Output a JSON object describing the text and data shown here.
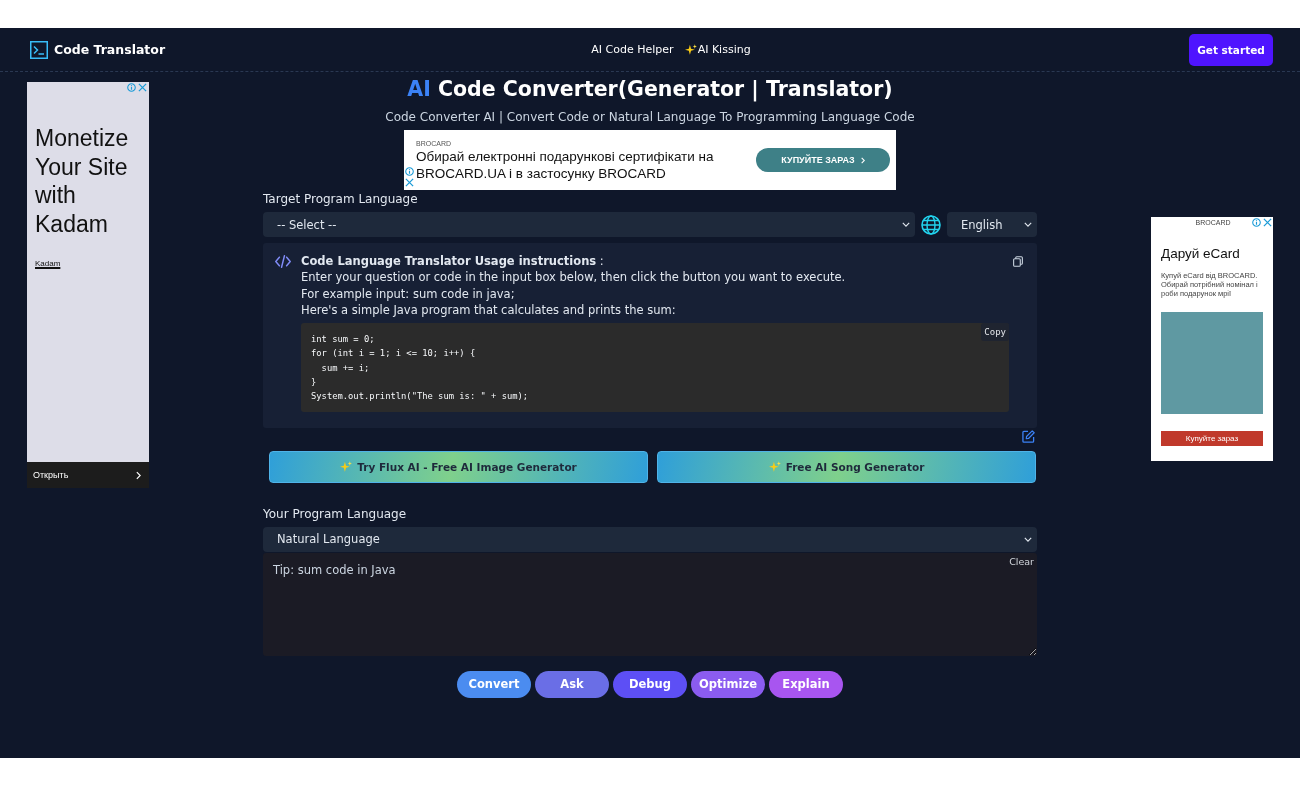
{
  "header": {
    "logo": "Code Translator",
    "nav": [
      {
        "label": "AI Code Helper",
        "kind": "plain"
      },
      {
        "label": "AI Kissing",
        "kind": "sparkle"
      }
    ],
    "cta": "Get started"
  },
  "left_ad": {
    "headline": "Monetize Your Site with Kadam",
    "brand": "Kadam",
    "footer_button": "Открыть"
  },
  "hero": {
    "title_accent": "AI",
    "title": "Code Converter(Generator | Translator)",
    "subtitle": "Code Converter AI | Convert Code or Natural Language To Programming Language Code"
  },
  "banner_ad": {
    "advertiser": "BROCARD",
    "text": "Обирай електронні подарункові сертифікати на BROCARD.UA і в застосунку BROCARD",
    "button": "КУПУЙТЕ ЗАРАЗ"
  },
  "target": {
    "label": "Target Program Language",
    "value": "-- Select --",
    "ui_language": "English"
  },
  "instructions": {
    "title": "**Code Language Translator Usage instructions** :",
    "lines": [
      "Enter your question or code in the input box below, then click the button you want to execute.",
      "For example input: sum code in java;",
      "Here's a simple Java program that calculates and prints the sum:"
    ],
    "code": [
      "int sum = 0;",
      "for (int i = 1; i <= 10; i++) {",
      "  sum += i;",
      "}",
      "System.out.println(\"The sum is: \" + sum);"
    ],
    "copy_button": "Copy"
  },
  "promo_buttons": [
    {
      "label": "Try Flux AI - Free AI Image Generator"
    },
    {
      "label": "Free AI Song Generator"
    }
  ],
  "source": {
    "label": "Your Program Language",
    "value": "Natural Language",
    "placeholder": "Tip: sum code in Java",
    "clear_button": "Clear"
  },
  "actions": [
    {
      "label": "Convert",
      "color": "#4b8cf0"
    },
    {
      "label": "Ask",
      "color": "#6a6ee6"
    },
    {
      "label": "Debug",
      "color": "#5d4ff5"
    },
    {
      "label": "Optimize",
      "color": "#8b5cf0"
    },
    {
      "label": "Explain",
      "color": "#a855f0"
    }
  ],
  "right_ad": {
    "advertiser": "BROCARD",
    "headline": "Даруй eCard",
    "body": "Купуй eCard від BROCARD. Обирай потрібний номінал і роби подарунок мрії",
    "button": "Купуйте зараз"
  }
}
